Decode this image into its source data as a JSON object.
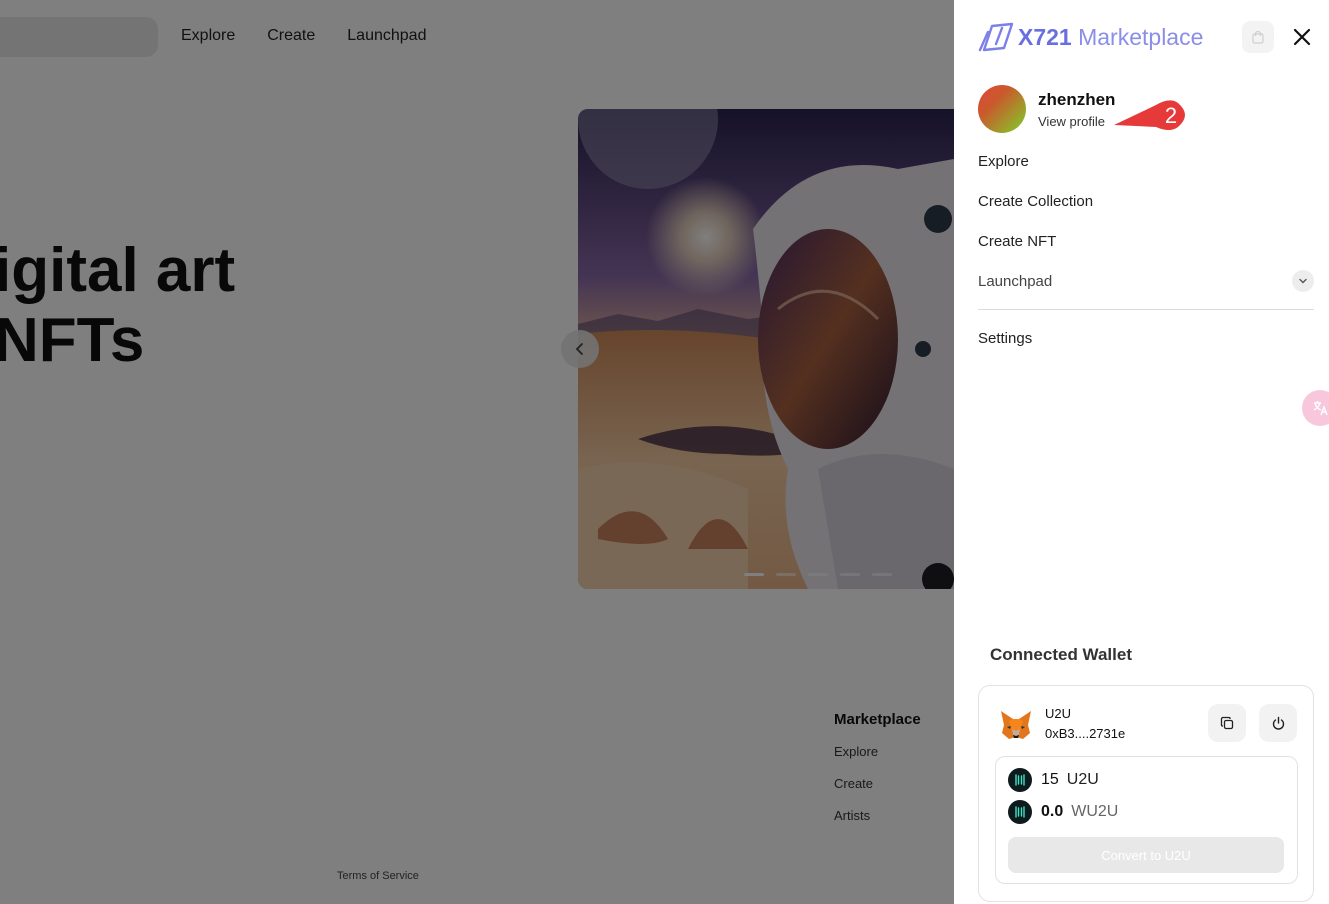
{
  "background": {
    "nav": [
      "Explore",
      "Create",
      "Launchpad"
    ],
    "hero_line1": "igital art",
    "hero_line2": "NFTs",
    "footer": {
      "title": "Marketplace",
      "links": [
        "Explore",
        "Create",
        "Artists"
      ],
      "terms": "Terms of Service"
    },
    "carousel_active_slide": 1,
    "carousel_slide_count": 5
  },
  "drawer": {
    "logo": {
      "brand": "X721",
      "product": "Marketplace"
    },
    "profile": {
      "username": "zhenzhen",
      "view_profile": "View profile"
    },
    "annotation_badge": "2",
    "menu": {
      "explore": "Explore",
      "create_collection": "Create Collection",
      "create_nft": "Create NFT",
      "launchpad": "Launchpad",
      "settings": "Settings"
    },
    "wallet": {
      "title": "Connected Wallet",
      "network": "U2U",
      "address": "0xB3....2731e",
      "balances": [
        {
          "amount": "15",
          "unit": "U2U"
        },
        {
          "amount": "0.0",
          "unit": "WU2U"
        }
      ],
      "convert_label": "Convert to U2U"
    }
  },
  "colors": {
    "brand": "#6a6fe0",
    "overlay": "rgba(0,0,0,0.5)",
    "badge": "#e63a3a"
  }
}
